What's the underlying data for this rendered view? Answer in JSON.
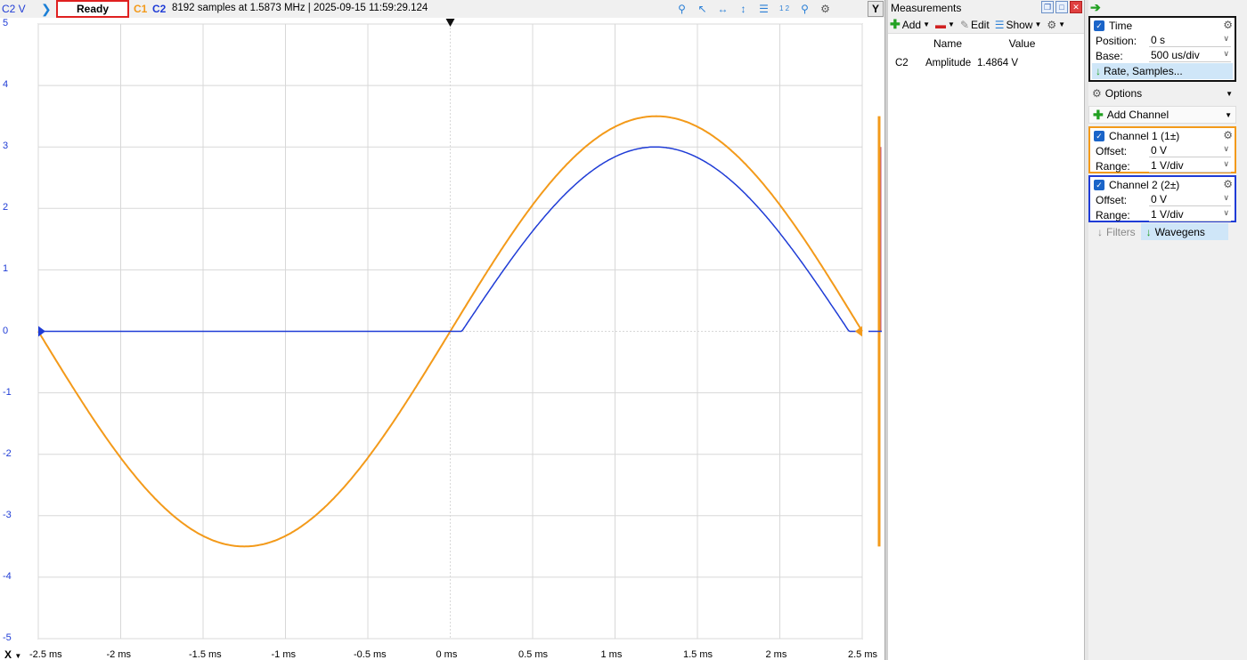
{
  "topbar": {
    "axis_label": "C2 V",
    "status": "Ready",
    "c1_label": "C1",
    "c2_label": "C2",
    "info": "8192 samples at 1.5873 MHz  | 2025-09-15 11:59:29.124",
    "y_button": "Y"
  },
  "plot": {
    "y_ticks": [
      "5",
      "4",
      "3",
      "2",
      "1",
      "0",
      "-1",
      "-2",
      "-3",
      "-4",
      "-5"
    ],
    "x_ticks": [
      "-2.5 ms",
      "-2 ms",
      "-1.5 ms",
      "-1 ms",
      "-0.5 ms",
      "0 ms",
      "0.5 ms",
      "1 ms",
      "1.5 ms",
      "2 ms",
      "2.5 ms"
    ],
    "x_axis_label": "X",
    "colors": {
      "c1": "#f39a1a",
      "c2": "#1f3cd6",
      "grid": "#d8d8d8"
    }
  },
  "chart_data": {
    "type": "line",
    "xlabel": "",
    "ylabel": "C2 V",
    "xlim": [
      -2.5,
      2.5
    ],
    "ylim": [
      -5,
      5
    ],
    "x_unit": "ms",
    "grid": true,
    "series": [
      {
        "name": "C1",
        "color": "#f39a1a",
        "amplitude": 3.5,
        "period_ms": 5,
        "phase": "inverted sine starting at -2.5 ms"
      },
      {
        "name": "C2",
        "color": "#1f3cd6",
        "shape": "half-wave rectified sine",
        "peak": 3.0,
        "conduction_start_ms": 0.07,
        "conduction_end_ms": 2.42
      }
    ]
  },
  "measurements": {
    "title": "Measurements",
    "toolbar": {
      "add": "Add",
      "edit": "Edit",
      "show": "Show"
    },
    "columns": [
      "Name",
      "Value"
    ],
    "rows": [
      {
        "channel": "C2",
        "name": "Amplitude",
        "value": "1.4864 V"
      }
    ]
  },
  "right": {
    "time": {
      "title": "Time",
      "position_label": "Position:",
      "position": "0 s",
      "base_label": "Base:",
      "base": "500 us/div",
      "rate_button": "Rate, Samples..."
    },
    "options": "Options",
    "add_channel": "Add Channel",
    "ch1": {
      "title": "Channel 1 (1±)",
      "offset_label": "Offset:",
      "offset": "0 V",
      "range_label": "Range:",
      "range": "1 V/div",
      "border": "#f39a1a"
    },
    "ch2": {
      "title": "Channel 2 (2±)",
      "offset_label": "Offset:",
      "offset": "0 V",
      "range_label": "Range:",
      "range": "1 V/div",
      "border": "#1f3cd6"
    },
    "filters": "Filters",
    "wavegens": "Wavegens"
  }
}
